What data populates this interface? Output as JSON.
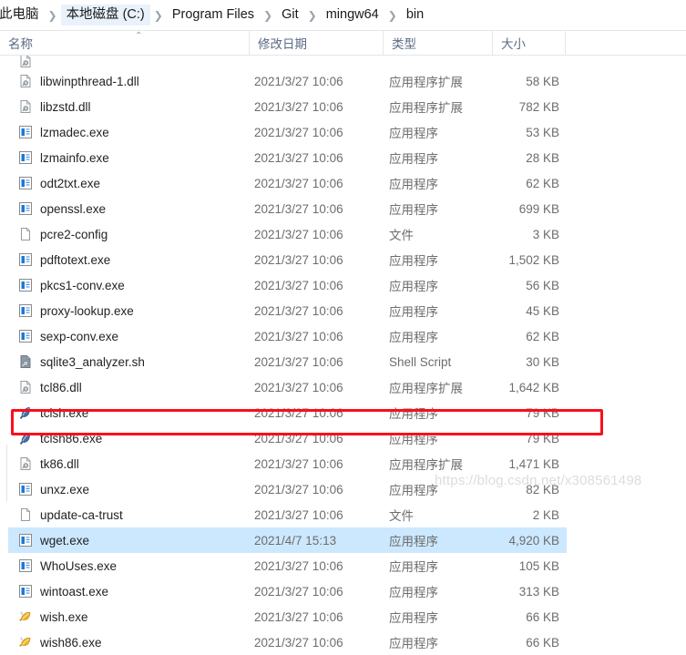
{
  "breadcrumb": {
    "items": [
      {
        "label": "此电脑",
        "clipped": true,
        "active": false
      },
      {
        "label": "本地磁盘 (C:)",
        "clipped": false,
        "active": true
      },
      {
        "label": "Program Files",
        "clipped": false,
        "active": false
      },
      {
        "label": "Git",
        "clipped": false,
        "active": false
      },
      {
        "label": "mingw64",
        "clipped": false,
        "active": false
      },
      {
        "label": "bin",
        "clipped": false,
        "active": false
      }
    ],
    "separator": "❯"
  },
  "columns": {
    "name": "名称",
    "date_modified": "修改日期",
    "type": "类型",
    "size": "大小",
    "sort_caret": "⌃"
  },
  "colors": {
    "selection": "#cce8ff",
    "annotation": "#fc0d1b",
    "header_text": "#5a6b84",
    "watermark": "#d8dde2"
  },
  "watermark": "https://blog.csdn.net/x308561498",
  "files": [
    {
      "name": "",
      "date": "",
      "type": "",
      "size": "",
      "icon": "dll-icon",
      "partial": true,
      "selected": false
    },
    {
      "name": "libwinpthread-1.dll",
      "date": "2021/3/27 10:06",
      "type": "应用程序扩展",
      "size": "58 KB",
      "icon": "dll-icon",
      "selected": false
    },
    {
      "name": "libzstd.dll",
      "date": "2021/3/27 10:06",
      "type": "应用程序扩展",
      "size": "782 KB",
      "icon": "dll-icon",
      "selected": false
    },
    {
      "name": "lzmadec.exe",
      "date": "2021/3/27 10:06",
      "type": "应用程序",
      "size": "53 KB",
      "icon": "exe-icon",
      "selected": false
    },
    {
      "name": "lzmainfo.exe",
      "date": "2021/3/27 10:06",
      "type": "应用程序",
      "size": "28 KB",
      "icon": "exe-icon",
      "selected": false
    },
    {
      "name": "odt2txt.exe",
      "date": "2021/3/27 10:06",
      "type": "应用程序",
      "size": "62 KB",
      "icon": "exe-icon",
      "selected": false
    },
    {
      "name": "openssl.exe",
      "date": "2021/3/27 10:06",
      "type": "应用程序",
      "size": "699 KB",
      "icon": "exe-icon",
      "selected": false
    },
    {
      "name": "pcre2-config",
      "date": "2021/3/27 10:06",
      "type": "文件",
      "size": "3 KB",
      "icon": "blank-file-icon",
      "selected": false
    },
    {
      "name": "pdftotext.exe",
      "date": "2021/3/27 10:06",
      "type": "应用程序",
      "size": "1,502 KB",
      "icon": "exe-icon",
      "selected": false
    },
    {
      "name": "pkcs1-conv.exe",
      "date": "2021/3/27 10:06",
      "type": "应用程序",
      "size": "56 KB",
      "icon": "exe-icon",
      "selected": false
    },
    {
      "name": "proxy-lookup.exe",
      "date": "2021/3/27 10:06",
      "type": "应用程序",
      "size": "45 KB",
      "icon": "exe-icon",
      "selected": false
    },
    {
      "name": "sexp-conv.exe",
      "date": "2021/3/27 10:06",
      "type": "应用程序",
      "size": "62 KB",
      "icon": "exe-icon",
      "selected": false
    },
    {
      "name": "sqlite3_analyzer.sh",
      "date": "2021/3/27 10:06",
      "type": "Shell Script",
      "size": "30 KB",
      "icon": "shell-script-icon",
      "selected": false
    },
    {
      "name": "tcl86.dll",
      "date": "2021/3/27 10:06",
      "type": "应用程序扩展",
      "size": "1,642 KB",
      "icon": "dll-icon",
      "selected": false
    },
    {
      "name": "tclsh.exe",
      "date": "2021/3/27 10:06",
      "type": "应用程序",
      "size": "79 KB",
      "icon": "feather-blue-icon",
      "selected": false
    },
    {
      "name": "tclsh86.exe",
      "date": "2021/3/27 10:06",
      "type": "应用程序",
      "size": "79 KB",
      "icon": "feather-blue-icon",
      "selected": false
    },
    {
      "name": "tk86.dll",
      "date": "2021/3/27 10:06",
      "type": "应用程序扩展",
      "size": "1,471 KB",
      "icon": "dll-icon",
      "selected": false
    },
    {
      "name": "unxz.exe",
      "date": "2021/3/27 10:06",
      "type": "应用程序",
      "size": "82 KB",
      "icon": "exe-icon",
      "selected": false
    },
    {
      "name": "update-ca-trust",
      "date": "2021/3/27 10:06",
      "type": "文件",
      "size": "2 KB",
      "icon": "blank-file-icon",
      "selected": false
    },
    {
      "name": "wget.exe",
      "date": "2021/4/7 15:13",
      "type": "应用程序",
      "size": "4,920 KB",
      "icon": "exe-icon",
      "selected": true
    },
    {
      "name": "WhoUses.exe",
      "date": "2021/3/27 10:06",
      "type": "应用程序",
      "size": "105 KB",
      "icon": "exe-icon",
      "selected": false
    },
    {
      "name": "wintoast.exe",
      "date": "2021/3/27 10:06",
      "type": "应用程序",
      "size": "313 KB",
      "icon": "exe-icon",
      "selected": false
    },
    {
      "name": "wish.exe",
      "date": "2021/3/27 10:06",
      "type": "应用程序",
      "size": "66 KB",
      "icon": "feather-yellow-icon",
      "selected": false
    },
    {
      "name": "wish86.exe",
      "date": "2021/3/27 10:06",
      "type": "应用程序",
      "size": "66 KB",
      "icon": "feather-yellow-icon",
      "selected": false
    }
  ]
}
